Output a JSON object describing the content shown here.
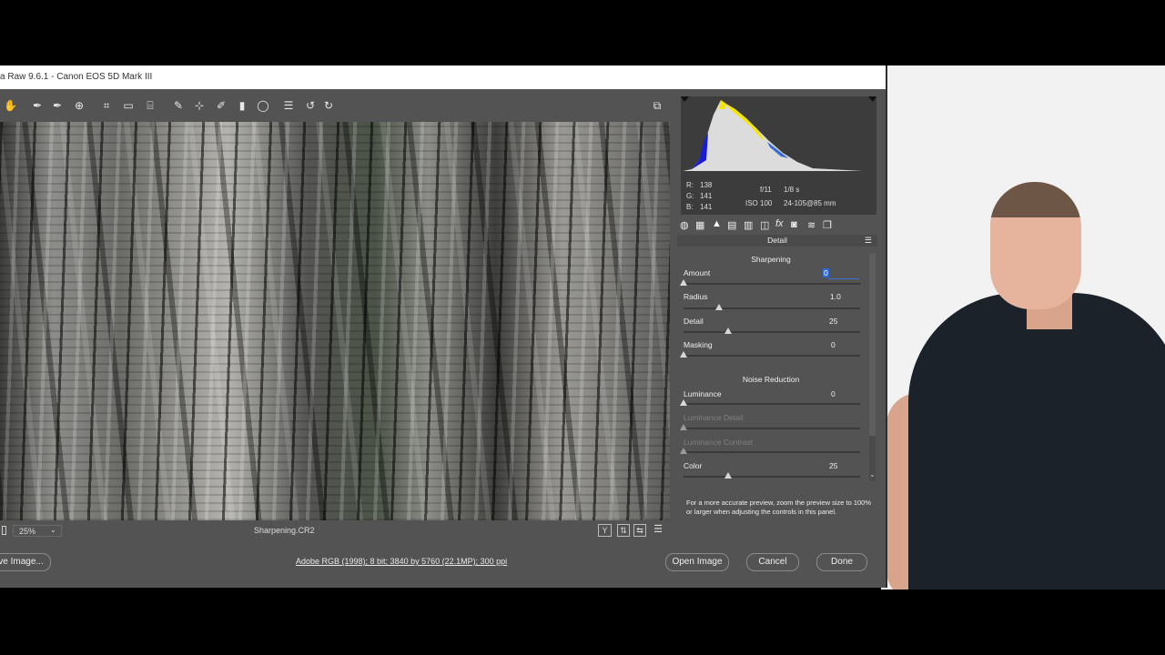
{
  "window": {
    "title": "a Raw 9.6.1  -  Canon EOS 5D Mark III"
  },
  "toolbar": {
    "tools": [
      {
        "icon": "hand-icon",
        "glyph": "✋"
      },
      {
        "icon": "white-balance-icon",
        "glyph": "✒"
      },
      {
        "icon": "color-sampler-icon",
        "glyph": "✒"
      },
      {
        "icon": "targeted-adjustment-icon",
        "glyph": "⊕"
      },
      {
        "icon": "crop-icon",
        "glyph": "⌗"
      },
      {
        "icon": "straighten-icon",
        "glyph": "▭"
      },
      {
        "icon": "transform-icon",
        "glyph": "⌸"
      },
      {
        "icon": "spot-removal-icon",
        "glyph": "✎"
      },
      {
        "icon": "red-eye-icon",
        "glyph": "⊹"
      },
      {
        "icon": "adjustment-brush-icon",
        "glyph": "✐"
      },
      {
        "icon": "graduated-filter-icon",
        "glyph": "▮"
      },
      {
        "icon": "radial-filter-icon",
        "glyph": "◯"
      },
      {
        "icon": "preferences-icon",
        "glyph": "☰"
      },
      {
        "icon": "rotate-left-icon",
        "glyph": "↺"
      },
      {
        "icon": "rotate-right-icon",
        "glyph": "↻"
      }
    ],
    "fullscreen_icon": "fullscreen-icon"
  },
  "camera": {
    "r_label": "R:",
    "r_value": "138",
    "g_label": "G:",
    "g_value": "141",
    "b_label": "B:",
    "b_value": "141",
    "aperture": "f/11",
    "shutter": "1/8 s",
    "iso": "ISO 100",
    "lens": "24-105@85 mm"
  },
  "panel": {
    "title": "Detail",
    "sharpening": {
      "title": "Sharpening",
      "amount_label": "Amount",
      "amount_value": "0",
      "radius_label": "Radius",
      "radius_value": "1.0",
      "detail_label": "Detail",
      "detail_value": "25",
      "masking_label": "Masking",
      "masking_value": "0"
    },
    "noise": {
      "title": "Noise Reduction",
      "luminance_label": "Luminance",
      "luminance_value": "0",
      "lum_detail_label": "Luminance Detail",
      "lum_contrast_label": "Luminance Contrast",
      "color_label": "Color",
      "color_value": "25"
    },
    "hint": "For a more accurate preview, zoom the preview size to 100% or larger when adjusting the controls in this panel."
  },
  "statusbar": {
    "zoom": "25%",
    "filename": "Sharpening.CR2"
  },
  "bottom": {
    "save_label": "ve Image...",
    "info_link": "Adobe RGB (1998); 8 bit; 3840 by 5760 (22.1MP); 300 ppi",
    "open_label": "Open Image",
    "cancel_label": "Cancel",
    "done_label": "Done"
  },
  "slider_levels": {
    "amount": 0,
    "radius": 0.2,
    "detail": 0.25,
    "masking": 0,
    "luminance": 0,
    "luminance_detail": 0,
    "luminance_contrast": 0,
    "color": 0.25
  }
}
